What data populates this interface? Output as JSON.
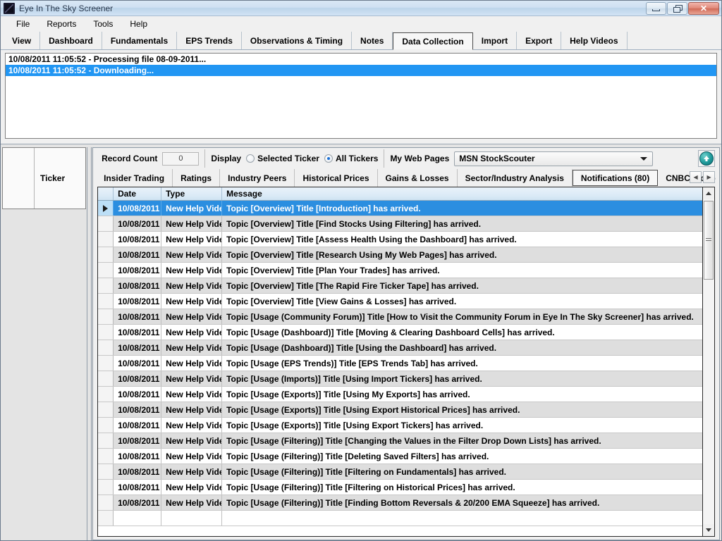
{
  "window": {
    "title": "Eye In The Sky Screener",
    "logo_icon": "app-logo-icon",
    "minimize_label": "Minimize",
    "maximize_label": "Restore",
    "close_label": "✕"
  },
  "menubar": {
    "items": [
      {
        "label": "File"
      },
      {
        "label": "Reports"
      },
      {
        "label": "Tools"
      },
      {
        "label": "Help"
      }
    ]
  },
  "main_tabs": {
    "selected": "Data Collection",
    "items": [
      {
        "label": "View"
      },
      {
        "label": "Dashboard"
      },
      {
        "label": "Fundamentals"
      },
      {
        "label": "EPS Trends"
      },
      {
        "label": "Observations & Timing"
      },
      {
        "label": "Notes"
      },
      {
        "label": "Data Collection"
      },
      {
        "label": "Import"
      },
      {
        "label": "Export"
      },
      {
        "label": "Help Videos"
      }
    ]
  },
  "log_panel": {
    "lines": [
      {
        "text": "10/08/2011 11:05:52 - Processing file 08-09-2011...",
        "selected": false
      },
      {
        "text": "10/08/2011 11:05:52 - Downloading...",
        "selected": true
      }
    ]
  },
  "ticker_panel": {
    "header": "Ticker"
  },
  "toolbar": {
    "record_count_label": "Record Count",
    "record_count_value": "0",
    "display_label": "Display",
    "radio_selected_ticker": "Selected Ticker",
    "radio_all_tickers": "All Tickers",
    "radio_checked": "All Tickers",
    "my_web_pages_label": "My Web Pages",
    "my_web_pages_value": "MSN StockScouter",
    "my_web_pages_options": [
      "MSN StockScouter"
    ],
    "scroll_top_icon": "up-arrow-circle-icon"
  },
  "sub_tabs": {
    "selected": "Notifications (80)",
    "items": [
      {
        "label": "Insider Trading"
      },
      {
        "label": "Ratings"
      },
      {
        "label": "Industry Peers"
      },
      {
        "label": "Historical Prices"
      },
      {
        "label": "Gains & Losses"
      },
      {
        "label": "Sector/Industry Analysis"
      },
      {
        "label": "Notifications (80)"
      },
      {
        "label": "CNBC Video"
      }
    ],
    "nav_prev_icon": "chevron-left-icon",
    "nav_next_icon": "chevron-right-icon"
  },
  "grid": {
    "columns": [
      "",
      "Date",
      "Type",
      "Message"
    ],
    "rows": [
      {
        "date": "10/08/2011",
        "type": "New Help Video",
        "message": "Topic [Overview] Title [Introduction] has arrived.",
        "selected": true
      },
      {
        "date": "10/08/2011",
        "type": "New Help Video",
        "message": "Topic [Overview] Title [Find Stocks Using Filtering] has arrived.",
        "selected": false
      },
      {
        "date": "10/08/2011",
        "type": "New Help Video",
        "message": "Topic [Overview] Title [Assess Health Using the Dashboard] has arrived.",
        "selected": false
      },
      {
        "date": "10/08/2011",
        "type": "New Help Video",
        "message": "Topic [Overview] Title [Research Using My Web Pages] has arrived.",
        "selected": false
      },
      {
        "date": "10/08/2011",
        "type": "New Help Video",
        "message": "Topic [Overview] Title [Plan Your Trades] has arrived.",
        "selected": false
      },
      {
        "date": "10/08/2011",
        "type": "New Help Video",
        "message": "Topic [Overview] Title [The Rapid Fire Ticker Tape] has arrived.",
        "selected": false
      },
      {
        "date": "10/08/2011",
        "type": "New Help Video",
        "message": "Topic [Overview] Title [View Gains & Losses] has arrived.",
        "selected": false
      },
      {
        "date": "10/08/2011",
        "type": "New Help Video",
        "message": "Topic [Usage (Community Forum)] Title [How to Visit the Community Forum in Eye In The Sky Screener] has arrived.",
        "selected": false
      },
      {
        "date": "10/08/2011",
        "type": "New Help Video",
        "message": "Topic [Usage (Dashboard)] Title [Moving & Clearing Dashboard Cells] has arrived.",
        "selected": false
      },
      {
        "date": "10/08/2011",
        "type": "New Help Video",
        "message": "Topic [Usage (Dashboard)] Title [Using the Dashboard] has arrived.",
        "selected": false
      },
      {
        "date": "10/08/2011",
        "type": "New Help Video",
        "message": "Topic [Usage (EPS Trends)] Title [EPS Trends Tab] has arrived.",
        "selected": false
      },
      {
        "date": "10/08/2011",
        "type": "New Help Video",
        "message": "Topic [Usage (Imports)] Title [Using Import Tickers] has arrived.",
        "selected": false
      },
      {
        "date": "10/08/2011",
        "type": "New Help Video",
        "message": "Topic [Usage (Exports)] Title [Using My Exports] has arrived.",
        "selected": false
      },
      {
        "date": "10/08/2011",
        "type": "New Help Video",
        "message": "Topic [Usage (Exports)] Title [Using Export Historical Prices] has arrived.",
        "selected": false
      },
      {
        "date": "10/08/2011",
        "type": "New Help Video",
        "message": "Topic [Usage (Exports)] Title [Using Export Tickers] has arrived.",
        "selected": false
      },
      {
        "date": "10/08/2011",
        "type": "New Help Video",
        "message": "Topic [Usage (Filtering)] Title [Changing the Values in the Filter Drop Down Lists] has arrived.",
        "selected": false
      },
      {
        "date": "10/08/2011",
        "type": "New Help Video",
        "message": "Topic [Usage (Filtering)] Title [Deleting Saved Filters] has arrived.",
        "selected": false
      },
      {
        "date": "10/08/2011",
        "type": "New Help Video",
        "message": "Topic [Usage (Filtering)] Title [Filtering on Fundamentals] has arrived.",
        "selected": false
      },
      {
        "date": "10/08/2011",
        "type": "New Help Video",
        "message": "Topic [Usage (Filtering)] Title [Filtering on Historical Prices] has arrived.",
        "selected": false
      },
      {
        "date": "10/08/2011",
        "type": "New Help Video",
        "message": "Topic [Usage (Filtering)] Title [Finding Bottom Reversals & 20/200 EMA Squeeze] has arrived.",
        "selected": false
      },
      {
        "date": "",
        "type": "",
        "message": "",
        "selected": false
      }
    ],
    "row_selector_icon": "row-selector-arrow-icon",
    "scroll_up_icon": "scroll-up-icon",
    "scroll_down_icon": "scroll-down-icon"
  },
  "colors": {
    "selection_blue": "#2b8ee0",
    "log_selection_blue": "#2196f3",
    "header_blue": "#cfe3f2",
    "alt_row_gray": "#dedede",
    "accent_teal": "#1f9b9b"
  }
}
